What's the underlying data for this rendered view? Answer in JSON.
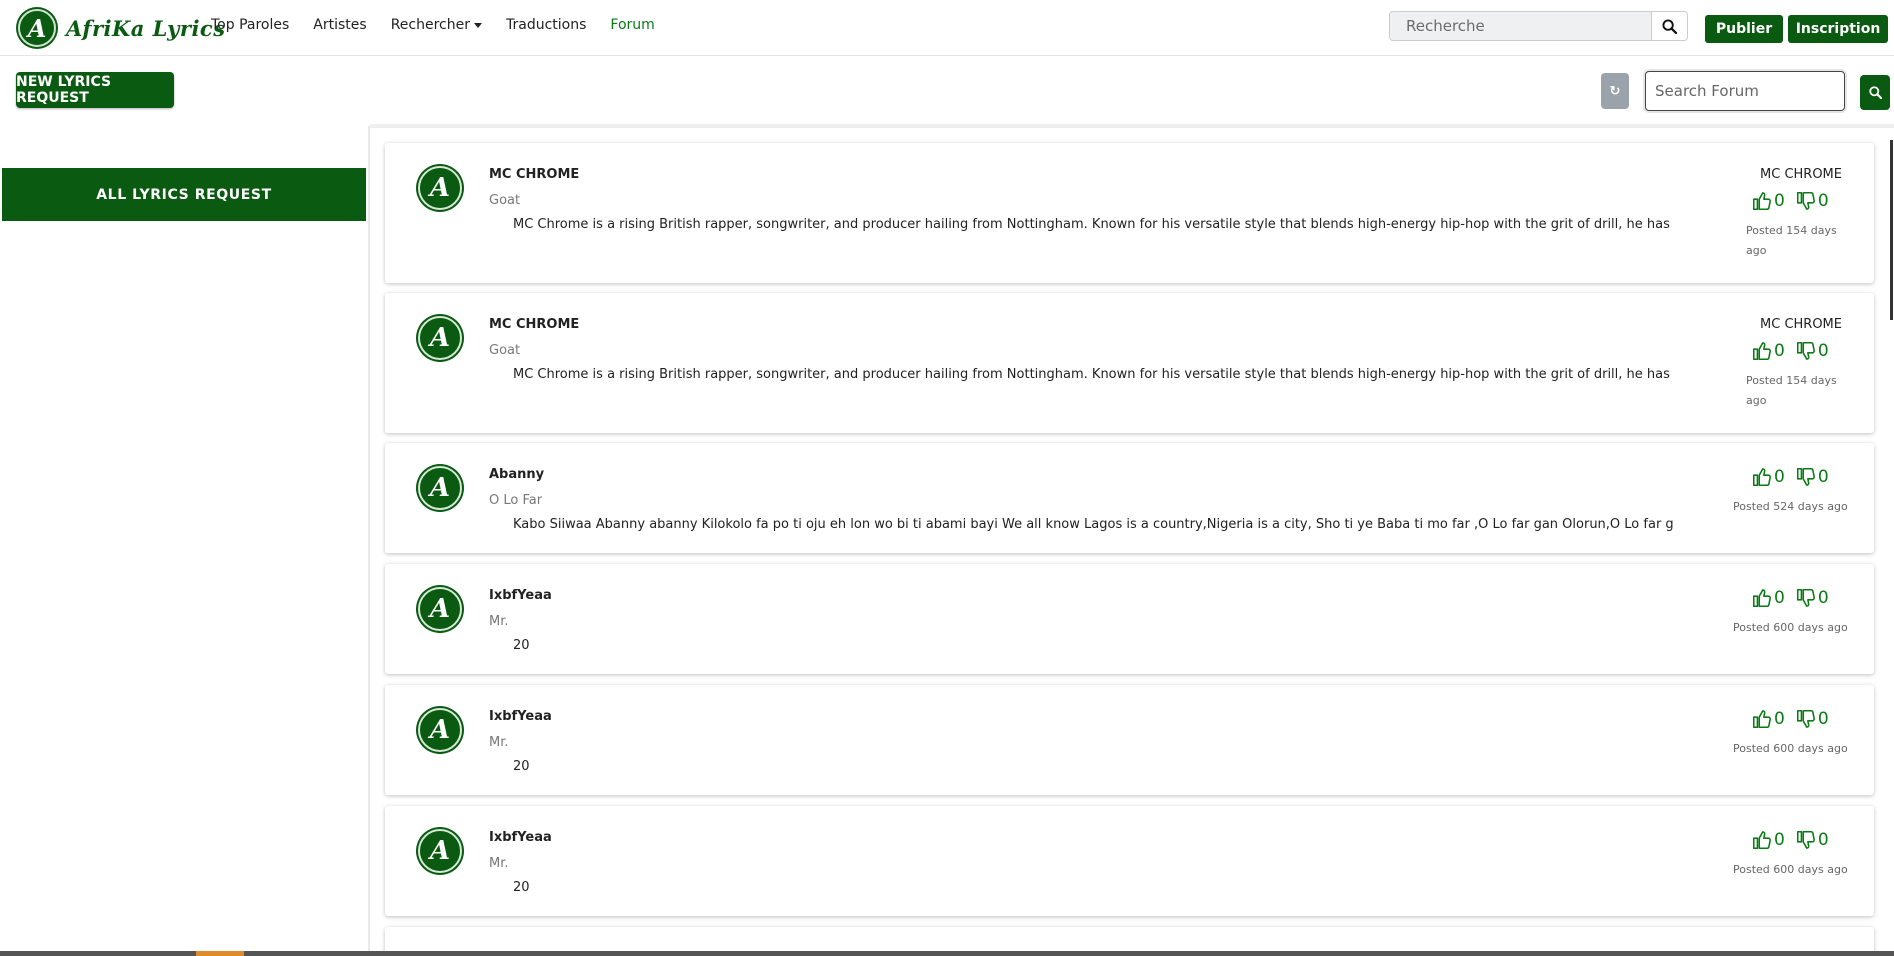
{
  "header": {
    "brand": "AfriKa Lyrics",
    "logo_letter": "A",
    "nav": [
      "Top Paroles",
      "Artistes",
      "Rechercher",
      "Traductions",
      "Forum"
    ],
    "search_placeholder": "Recherche",
    "publier": "Publier",
    "inscription": "Inscription"
  },
  "toolbar": {
    "new_request": "NEW LYRICS REQUEST",
    "refresh_glyph": "↻",
    "forum_search_placeholder": "Search Forum"
  },
  "sidebar": {
    "items": [
      "ALL LYRICS REQUEST"
    ]
  },
  "posts": [
    {
      "author": "MC CHROME",
      "title": "Goat",
      "body": "MC Chrome is a rising British rapper, songwriter, and producer hailing from Nottingham. Known for his versatile style that blends high-energy hip-hop with the grit of drill, he has recently g",
      "meta_author": "MC CHROME",
      "likes": "0",
      "dislikes": "0",
      "posted_line1": "Posted 154 days",
      "posted_line2": "ago"
    },
    {
      "author": "MC CHROME",
      "title": "Goat",
      "body": "MC Chrome is a rising British rapper, songwriter, and producer hailing from Nottingham. Known for his versatile style that blends high-energy hip-hop with the grit of drill, he has recently g",
      "meta_author": "MC CHROME",
      "likes": "0",
      "dislikes": "0",
      "posted_line1": "Posted 154 days",
      "posted_line2": "ago"
    },
    {
      "author": "Abanny",
      "title": "O Lo Far",
      "body": "Kabo Siiwaa Abanny abanny Kilokolo fa po ti oju eh lon wo bi ti abami bayi We all know Lagos is a country,Nigeria is a city, Sho ti ye Baba ti mo far ,O Lo far gan Olorun,O Lo far gan Sitin,",
      "meta_author": "",
      "likes": "0",
      "dislikes": "0",
      "posted_line1": "Posted 524 days ago",
      "posted_line2": ""
    },
    {
      "author": "IxbfYeaa",
      "title": "Mr.",
      "body": "20",
      "meta_author": "",
      "likes": "0",
      "dislikes": "0",
      "posted_line1": "Posted 600 days ago",
      "posted_line2": ""
    },
    {
      "author": "IxbfYeaa",
      "title": "Mr.",
      "body": "20",
      "meta_author": "",
      "likes": "0",
      "dislikes": "0",
      "posted_line1": "Posted 600 days ago",
      "posted_line2": ""
    },
    {
      "author": "IxbfYeaa",
      "title": "Mr.",
      "body": "20",
      "meta_author": "",
      "likes": "0",
      "dislikes": "0",
      "posted_line1": "Posted 600 days ago",
      "posted_line2": ""
    }
  ],
  "colors": {
    "brand_green": "#0b5a12",
    "link_green": "#0b7a16",
    "refresh_gray": "#9aa3ab"
  }
}
